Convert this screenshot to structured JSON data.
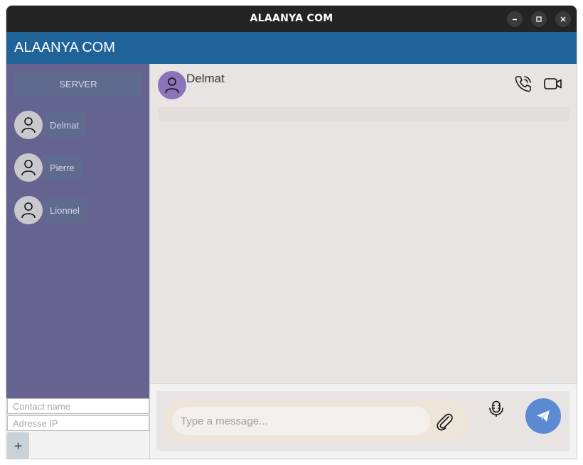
{
  "window": {
    "title": "ALAANYA COM"
  },
  "appbar": {
    "title": "ALAANYA COM"
  },
  "sidebar": {
    "server_label": "SERVER",
    "contacts": [
      {
        "name": "Delmat"
      },
      {
        "name": "Pierre"
      },
      {
        "name": "Lionnel"
      }
    ],
    "form": {
      "contact_name_placeholder": "Contact name",
      "ip_placeholder": "Adresse IP",
      "add_label": "+"
    }
  },
  "chat": {
    "contact_name": "Delmat",
    "composer": {
      "placeholder": "Type a message..."
    }
  },
  "icons": {
    "avatar": "user-icon",
    "call": "phone-call-icon",
    "video": "video-camera-icon",
    "attach": "paperclip-icon",
    "mic": "microphone-icon",
    "send": "paper-plane-icon"
  },
  "colors": {
    "titlebar": "#242424",
    "appbar": "#1f6399",
    "sidebar": "#676391",
    "contact_chip": "#5f6a8f",
    "chat_bg": "#e8e4e3",
    "active_avatar": "#8b74b7",
    "send_button": "#5a8ad1"
  }
}
